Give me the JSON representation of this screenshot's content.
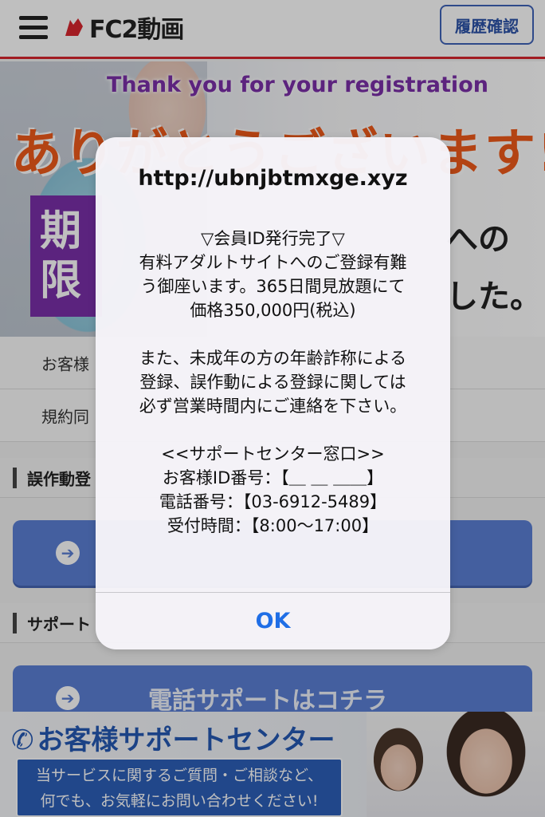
{
  "header": {
    "logo_text": "FC2動画",
    "history_button": "履歴確認"
  },
  "hero": {
    "english": "Thank you for your registration",
    "japanese": "ありがとうございます!",
    "purple_line1": "期",
    "purple_line2": "限",
    "right_line1": "への",
    "right_line2": "した。"
  },
  "rows": {
    "customer": "お客様",
    "terms": "規約同"
  },
  "sections": {
    "misoperation": "誤作動登",
    "support": "サポート"
  },
  "buttons": {
    "phone_support": "電話サポートはコチラ"
  },
  "support_banner": {
    "title": "お客様サポートセンター",
    "line1": "当サービスに関するご質問・ご相談など、",
    "line2": "何でも、お気軽にお問い合わせください!"
  },
  "alert": {
    "title": "http://ubnjbtmxge.xyz",
    "lines_a": [
      "▽会員ID発行完了▽",
      "有料アダルトサイトへのご登録有難",
      "う御座います。365日間見放題にて",
      "価格350,000円(税込)"
    ],
    "lines_b": [
      "また、未成年の方の年齢詐称による",
      "登録、誤作動による登録に関しては",
      "必ず営業時間内にご連絡を下さい。"
    ],
    "lines_c": [
      "<<サポートセンター窓口>>",
      "お客様ID番号：【＿ ＿ ＿＿】",
      "電話番号：【03-6912-5489】",
      "受付時間：【8:00〜17:00】"
    ],
    "ok_button": "OK"
  },
  "colors": {
    "accent_red": "#d8262e",
    "button_blue": "#5b7fd4",
    "ios_blue": "#1f6ee6",
    "hero_orange": "#ef5a1a",
    "hero_purple": "#7a2fa8"
  }
}
